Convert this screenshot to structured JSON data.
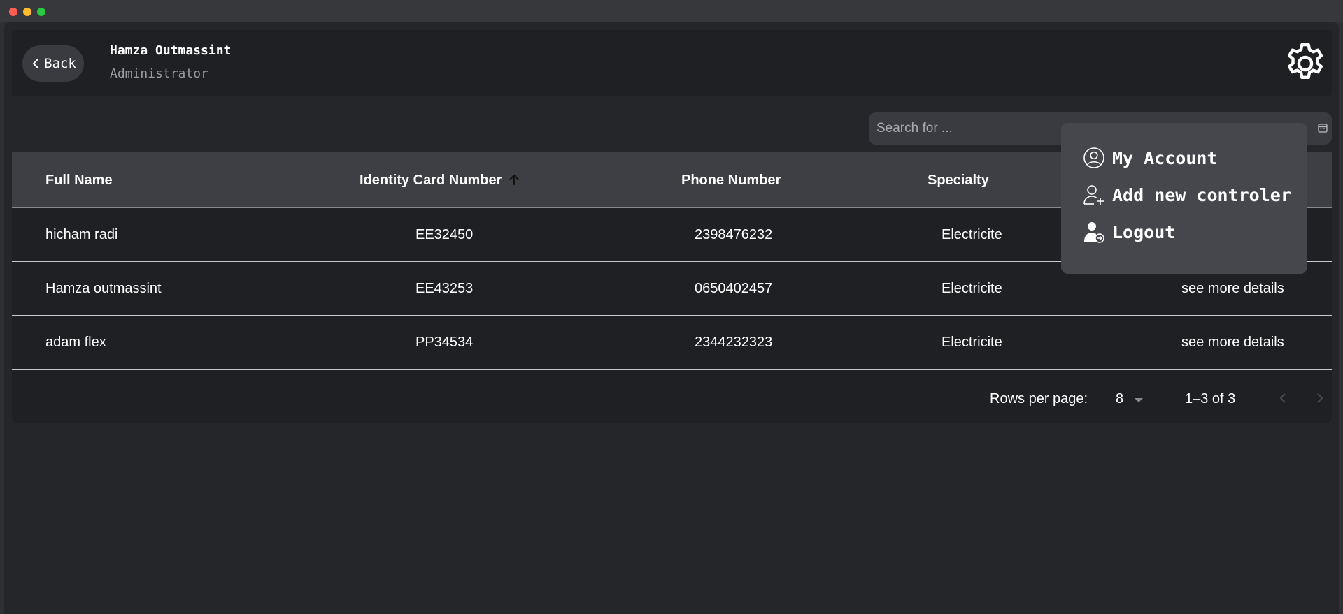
{
  "header": {
    "back_label": "Back",
    "user_name": "Hamza Outmassint",
    "user_role": "Administrator"
  },
  "search": {
    "placeholder": "Search for ..."
  },
  "table": {
    "columns": [
      "Full Name",
      "Identity Card Number",
      "Phone Number",
      "Specialty"
    ],
    "sorted_column": "Identity Card Number",
    "rows": [
      {
        "name": "hicham radi",
        "id": "EE32450",
        "phone": "2398476232",
        "specialty": "Electricite",
        "action": ""
      },
      {
        "name": "Hamza outmassint",
        "id": "EE43253",
        "phone": "0650402457",
        "specialty": "Electricite",
        "action": "see more details"
      },
      {
        "name": "adam flex",
        "id": "PP34534",
        "phone": "2344232323",
        "specialty": "Electricite",
        "action": "see more details"
      }
    ]
  },
  "pagination": {
    "rows_per_page_label": "Rows per page:",
    "rows_per_page": "8",
    "range": "1–3 of 3"
  },
  "menu": {
    "items": [
      {
        "label": "My Account",
        "icon": "account-circle-icon"
      },
      {
        "label": "Add new controler",
        "icon": "add-user-icon"
      },
      {
        "label": "Logout",
        "icon": "logout-user-icon"
      }
    ]
  },
  "colors": {
    "background": "#25262a",
    "surface": "#1f2024",
    "header_row": "#3e3f44",
    "menu": "#46474c"
  }
}
